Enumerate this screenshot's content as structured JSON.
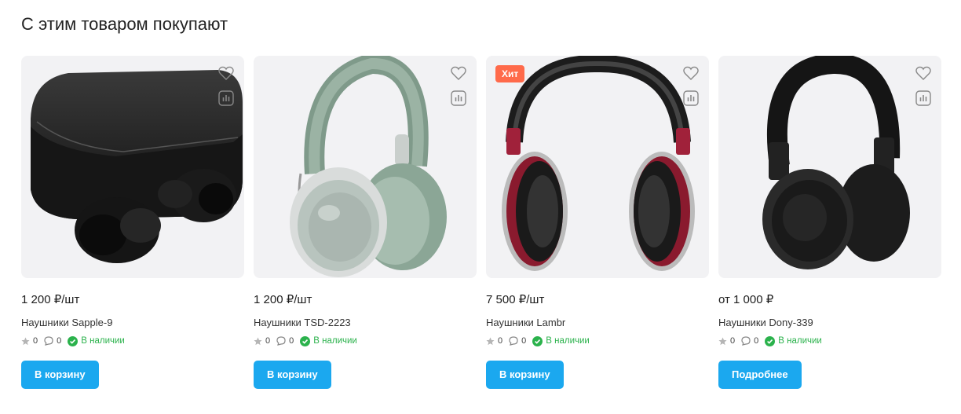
{
  "section": {
    "title": "С этим товаром покупают"
  },
  "colors": {
    "accent": "#1ba8ef",
    "hit_badge": "#ff6a4a",
    "in_stock": "#2bb24c",
    "card_bg": "#f2f2f4"
  },
  "products": [
    {
      "price": "1 200 ₽/шт",
      "name": "Наушники Sapple-9",
      "rating": "0",
      "reviews": "0",
      "stock": "В наличии",
      "button": "В корзину",
      "badge": ""
    },
    {
      "price": "1 200 ₽/шт",
      "name": "Наушники TSD-2223",
      "rating": "0",
      "reviews": "0",
      "stock": "В наличии",
      "button": "В корзину",
      "badge": ""
    },
    {
      "price": "7 500 ₽/шт",
      "name": "Наушники Lambr",
      "rating": "0",
      "reviews": "0",
      "stock": "В наличии",
      "button": "В корзину",
      "badge": "Хит"
    },
    {
      "price": "от 1 000 ₽",
      "name": "Наушники Dony-339",
      "rating": "0",
      "reviews": "0",
      "stock": "В наличии",
      "button": "Подробнее",
      "badge": ""
    }
  ],
  "icons": [
    "heart-icon",
    "compare-icon",
    "star-icon",
    "comment-icon",
    "check-circle-icon"
  ]
}
